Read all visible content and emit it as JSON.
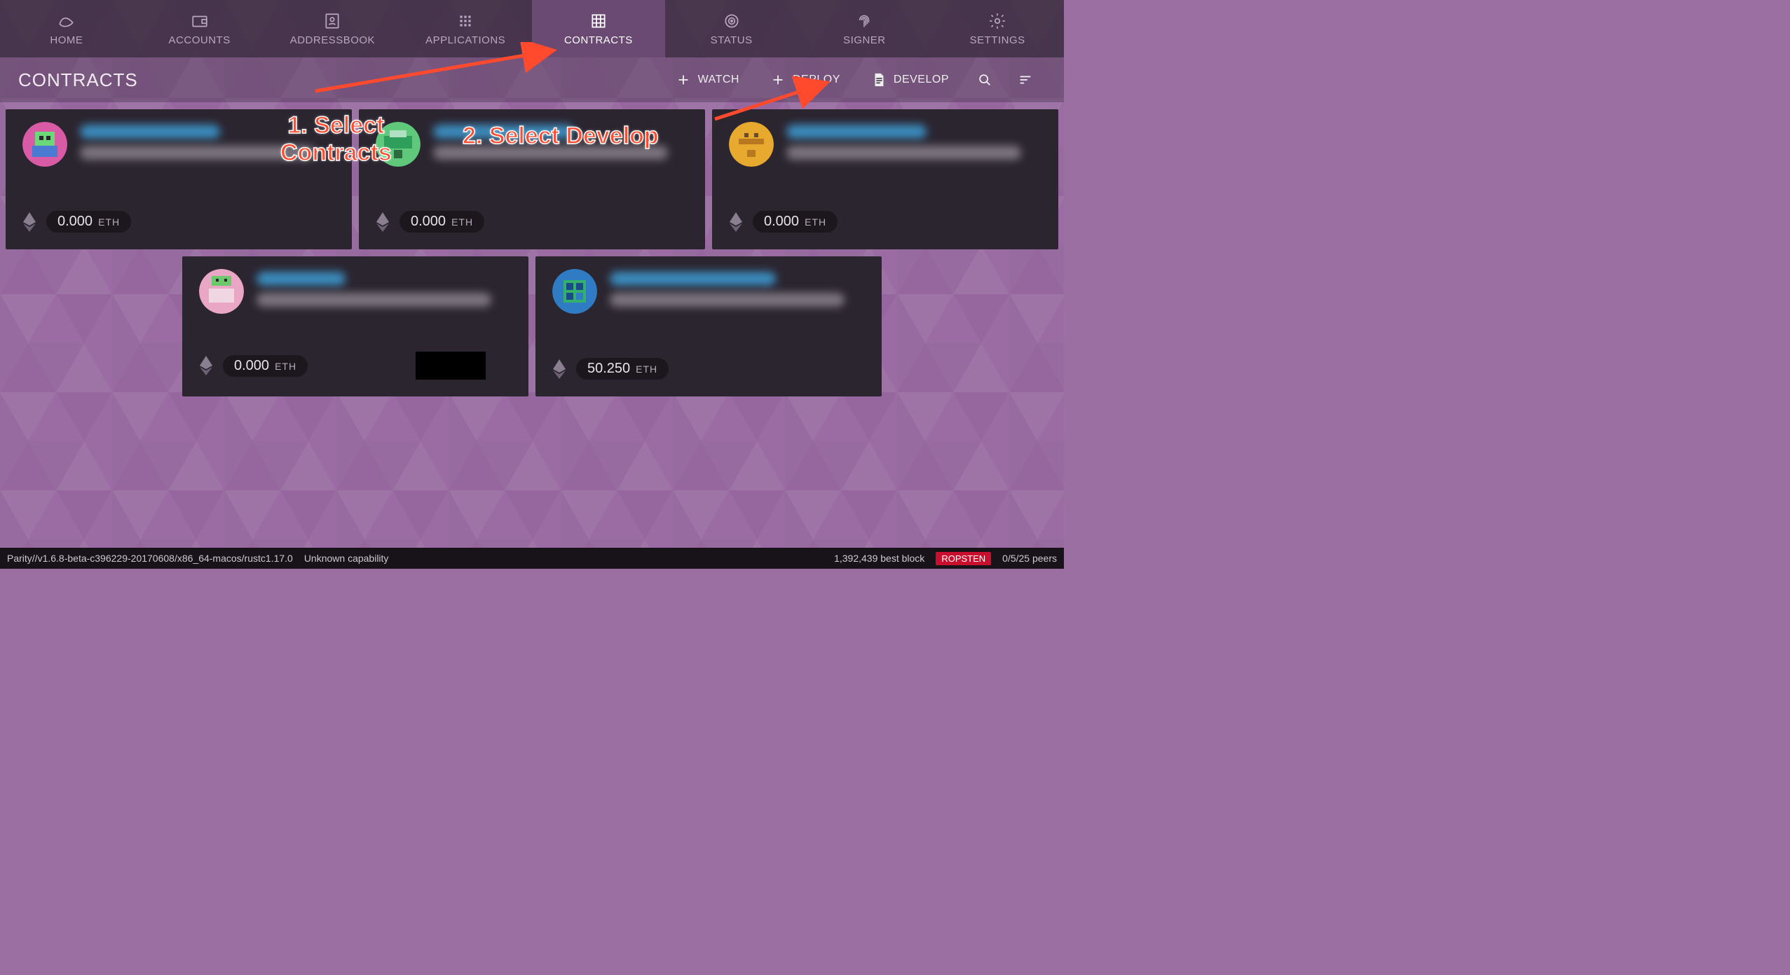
{
  "nav": {
    "items": [
      {
        "label": "HOME",
        "icon": "wave"
      },
      {
        "label": "ACCOUNTS",
        "icon": "wallet"
      },
      {
        "label": "ADDRESSBOOK",
        "icon": "contact"
      },
      {
        "label": "APPLICATIONS",
        "icon": "grid-small"
      },
      {
        "label": "CONTRACTS",
        "icon": "grid"
      },
      {
        "label": "STATUS",
        "icon": "target"
      },
      {
        "label": "SIGNER",
        "icon": "fingerprint"
      },
      {
        "label": "SETTINGS",
        "icon": "gear"
      }
    ],
    "active_index": 4
  },
  "subbar": {
    "title": "CONTRACTS",
    "actions": [
      {
        "label": "WATCH",
        "icon": "plus"
      },
      {
        "label": "DEPLOY",
        "icon": "plus"
      },
      {
        "label": "DEVELOP",
        "icon": "document"
      }
    ]
  },
  "contracts": [
    {
      "balance": "0.000",
      "currency": "ETH",
      "avatar_colors": [
        "#d95ba5",
        "#6bd977",
        "#4a7ad1"
      ]
    },
    {
      "balance": "0.000",
      "currency": "ETH",
      "avatar_colors": [
        "#5fc87a",
        "#2e9e5b",
        "#b0e0c2"
      ]
    },
    {
      "balance": "0.000",
      "currency": "ETH",
      "avatar_colors": [
        "#e8a92f",
        "#b87820",
        "#6b4a2a"
      ]
    },
    {
      "balance": "0.000",
      "currency": "ETH",
      "avatar_colors": [
        "#e9a7c5",
        "#6bc96b",
        "#f0d6e0"
      ],
      "redacted": true
    },
    {
      "balance": "50.250",
      "currency": "ETH",
      "avatar_colors": [
        "#2f7cc4",
        "#33b06b",
        "#1a4a8a"
      ]
    }
  ],
  "status": {
    "version": "Parity//v1.6.8-beta-c396229-20170608/x86_64-macos/rustc1.17.0",
    "capability": "Unknown capability",
    "best_block": "1,392,439 best block",
    "network": "ROPSTEN",
    "peers": "0/5/25 peers"
  },
  "annotations": {
    "step1": "1. Select\nContracts",
    "step2": "2. Select Develop"
  }
}
